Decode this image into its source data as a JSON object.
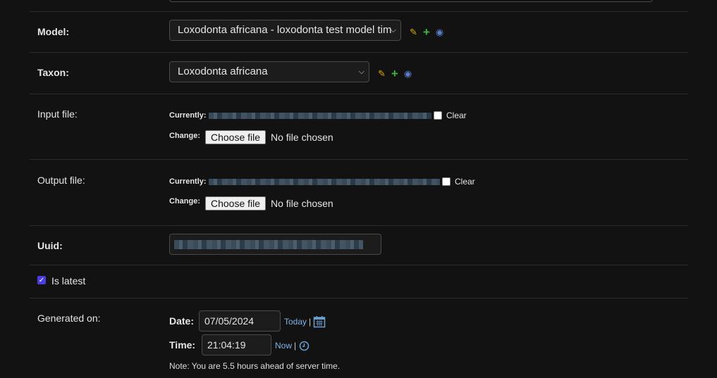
{
  "model": {
    "label": "Model:",
    "value": "Loxodonta africana - loxodonta test model tim"
  },
  "taxon": {
    "label": "Taxon:",
    "value": "Loxodonta africana"
  },
  "input_file": {
    "label": "Input file:",
    "currently_label": "Currently:",
    "clear_label": "Clear",
    "change_label": "Change:",
    "choose_label": "Choose file",
    "no_file": "No file chosen"
  },
  "output_file": {
    "label": "Output file:",
    "currently_label": "Currently:",
    "clear_label": "Clear",
    "change_label": "Change:",
    "choose_label": "Choose file",
    "no_file": "No file chosen"
  },
  "uuid": {
    "label": "Uuid:"
  },
  "is_latest": {
    "label": "Is latest",
    "checked": true
  },
  "generated_on": {
    "label": "Generated on:",
    "date_label": "Date:",
    "date_value": "07/05/2024",
    "today_link": "Today",
    "sep1": "|",
    "time_label": "Time:",
    "time_value": "21:04:19",
    "now_link": "Now",
    "sep2": "|",
    "note": "Note: You are 5.5 hours ahead of server time."
  },
  "icons": {
    "edit": "pencil-icon",
    "add": "plus-icon",
    "view": "eye-icon",
    "calendar": "calendar-icon",
    "clock": "clock-icon"
  },
  "colors": {
    "background": "#121212",
    "link": "#7cb4e6",
    "edit": "#d6a516",
    "add": "#3cb53c",
    "view": "#5b7cc9",
    "checkbox": "#4b3ee0"
  }
}
